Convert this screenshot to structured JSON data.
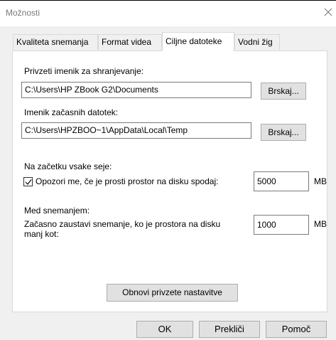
{
  "window": {
    "title": "Možnosti"
  },
  "tabs": [
    {
      "label": "Kvaliteta snemanja"
    },
    {
      "label": "Format videa"
    },
    {
      "label": "Ciljne datoteke"
    },
    {
      "label": "Vodni žig"
    }
  ],
  "active_tab": "Ciljne datoteke",
  "save_dir": {
    "label": "Privzeti imenik za shranjevanje:",
    "value": "C:\\Users\\HP ZBook G2\\Documents",
    "browse_label": "Brskaj..."
  },
  "temp_dir": {
    "label": "Imenik začasnih datotek:",
    "value": "C:\\Users\\HPZBOO~1\\AppData\\Local\\Temp",
    "browse_label": "Brskaj..."
  },
  "session_start": {
    "heading": "Na začetku vsake seje:",
    "warn_label": "Opozori me, če je prosti prostor na disku spodaj:",
    "warn_checked": true,
    "warn_value": "5000",
    "warn_unit": "MB"
  },
  "during_recording": {
    "heading": "Med snemanjem:",
    "pause_label_line1": "Začasno zaustavi snemanje, ko je prostora na disku",
    "pause_label_line2": "manj kot:",
    "pause_value": "1000",
    "pause_unit": "MB"
  },
  "restore_defaults_label": "Obnovi privzete nastavitve",
  "footer": {
    "ok_label": "OK",
    "cancel_label": "Prekliči",
    "help_label": "Pomoč"
  }
}
